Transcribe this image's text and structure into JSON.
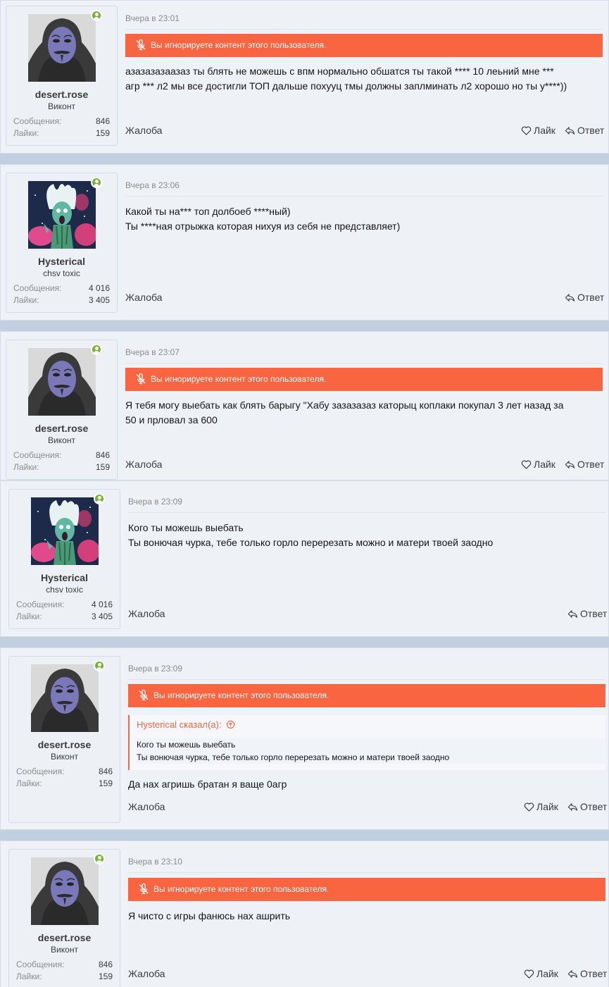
{
  "labels": {
    "report": "Жалоба",
    "like": "Лайк",
    "reply": "Ответ",
    "ignored_notice": "Вы игнорируете контент этого пользователя.",
    "messages": "Сообщения:",
    "likes": "Лайки:"
  },
  "icons": {
    "online": "online-user-icon",
    "ignored": "muted-speaker-icon",
    "like": "heart-icon",
    "reply": "reply-arrow-icon",
    "quote_jump": "arrow-up-circle-icon"
  },
  "colors": {
    "ignore_bar": "#f96540",
    "online_dot": "#78b337",
    "page_background": "#c2cfe0"
  },
  "posts": [
    {
      "user": {
        "name": "desert.rose",
        "title": "Виконт",
        "messages": "846",
        "likes": "159",
        "avatar": "mask-hood-avatar"
      },
      "date": "Вчера в 23:01",
      "ignored": true,
      "lines": [
        "азазазазаазаз ты блять не можешь с впм нормально обшатся ты такой **** 10 леьний мне ***",
        "агр *** л2 мы все достигли ТОП дальше похууц тмы должны заплминать л2 хорошо но ты у****))"
      ],
      "like": true
    },
    {
      "user": {
        "name": "Hysterical",
        "title": "chsv toxic",
        "messages": "4 016",
        "likes": "3 405",
        "avatar": "zombie-art-avatar"
      },
      "date": "Вчера в 23:06",
      "ignored": false,
      "lines": [
        "Какой ты на*** топ долбоеб ****ный)",
        "Ты ****ная отрыжка которая нихуя из себя не представляет)"
      ],
      "like": false
    },
    {
      "user": {
        "name": "desert.rose",
        "title": "Виконт",
        "messages": "846",
        "likes": "159",
        "avatar": "mask-hood-avatar"
      },
      "date": "Вчера в 23:07",
      "ignored": true,
      "lines": [
        "Я тебя могу выебать как блять барыгу \"Хабу зазазазаз каторыц коплаки покупал 3 лет назад за",
        "50 и прловал за 600"
      ],
      "like": true
    },
    {
      "user": {
        "name": "Hysterical",
        "title": "chsv toxic",
        "messages": "4 016",
        "likes": "3 405",
        "avatar": "zombie-art-avatar"
      },
      "date": "Вчера в 23:09",
      "ignored": false,
      "lines": [
        "Кого ты можешь выебать",
        "Ты вонючая чурка, тебе только горло перерезать можно и матери твоей заодно"
      ],
      "like": false
    },
    {
      "user": {
        "name": "desert.rose",
        "title": "Виконт",
        "messages": "846",
        "likes": "159",
        "avatar": "mask-hood-avatar"
      },
      "date": "Вчера в 23:09",
      "ignored": true,
      "quote": {
        "author": "Hysterical сказал(а):",
        "lines": [
          "Кого ты можешь выебать",
          "Ты вонючая чурка, тебе только горло перерезать можно и матери твоей заодно"
        ]
      },
      "lines": [
        "Да нах агришь братан я ваще 0агр"
      ],
      "like": true
    },
    {
      "user": {
        "name": "desert.rose",
        "title": "Виконт",
        "messages": "846",
        "likes": "159",
        "avatar": "mask-hood-avatar"
      },
      "date": "Вчера в 23:10",
      "ignored": true,
      "lines": [
        "Я чисто с игры фанюсь нах ашрить"
      ],
      "like": true
    }
  ]
}
